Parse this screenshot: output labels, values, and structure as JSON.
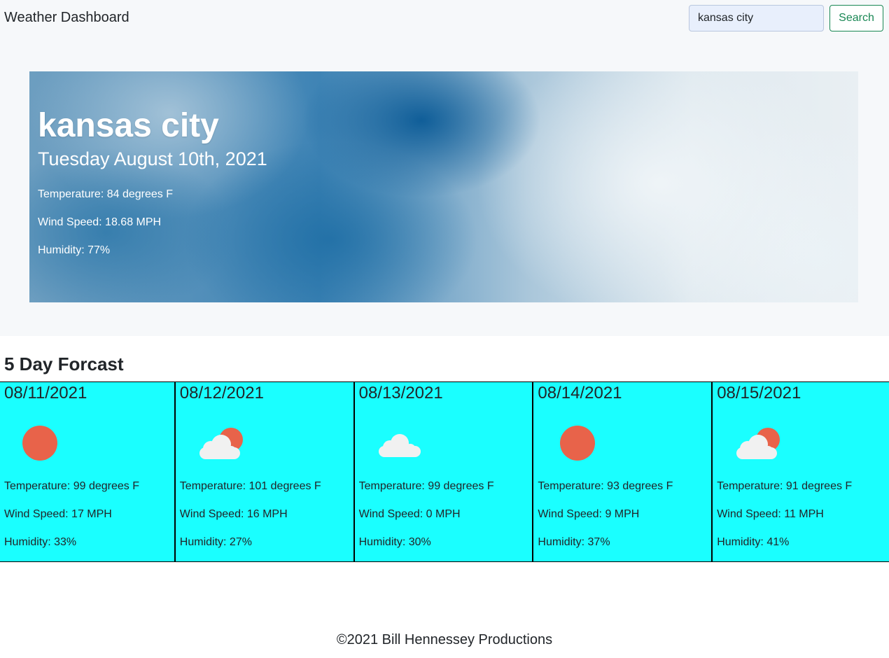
{
  "navbar": {
    "brand": "Weather Dashboard",
    "search_value": "kansas city",
    "search_button": "Search"
  },
  "current": {
    "city": "kansas city",
    "date": "Tuesday August 10th, 2021",
    "temperature": "Temperature: 84 degrees F",
    "wind": "Wind Speed: 18.68 MPH",
    "humidity": "Humidity: 77%"
  },
  "forecast": {
    "title": "5 Day Forcast",
    "days": [
      {
        "date": "08/11/2021",
        "icon": "sun-icon",
        "temperature": "Temperature: 99 degrees F",
        "wind": "Wind Speed: 17 MPH",
        "humidity": "Humidity: 33%"
      },
      {
        "date": "08/12/2021",
        "icon": "partly-cloudy-icon",
        "temperature": "Temperature: 101 degrees F",
        "wind": "Wind Speed: 16 MPH",
        "humidity": "Humidity: 27%"
      },
      {
        "date": "08/13/2021",
        "icon": "cloud-icon",
        "temperature": "Temperature: 99 degrees F",
        "wind": "Wind Speed: 0 MPH",
        "humidity": "Humidity: 30%"
      },
      {
        "date": "08/14/2021",
        "icon": "sun-icon",
        "temperature": "Temperature: 93 degrees F",
        "wind": "Wind Speed: 9 MPH",
        "humidity": "Humidity: 37%"
      },
      {
        "date": "08/15/2021",
        "icon": "partly-cloudy-icon",
        "temperature": "Temperature: 91 degrees F",
        "wind": "Wind Speed: 11 MPH",
        "humidity": "Humidity: 41%"
      }
    ]
  },
  "colors": {
    "card_background": "#1affff",
    "sun": "#e8634a",
    "cloud": "#f1f1f1",
    "accent": "#198754"
  },
  "footer": {
    "text": "©2021 Bill Hennessey Productions"
  }
}
